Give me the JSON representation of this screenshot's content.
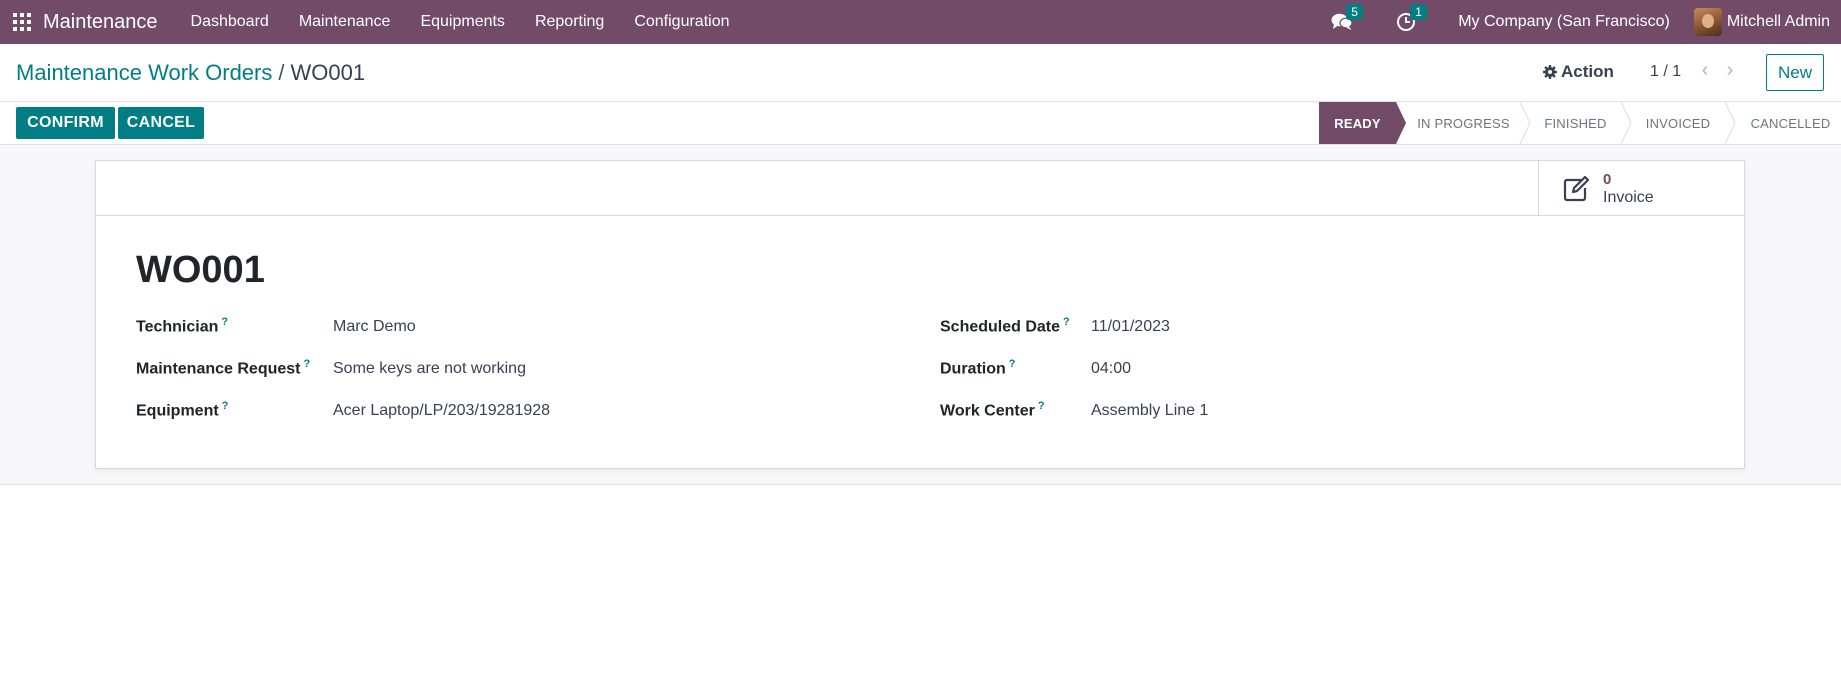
{
  "navbar": {
    "app_name": "Maintenance",
    "menus": [
      "Dashboard",
      "Maintenance",
      "Equipments",
      "Reporting",
      "Configuration"
    ],
    "messages_count": "5",
    "activities_count": "1",
    "company": "My Company (San Francisco)",
    "user": "Mitchell Admin"
  },
  "control": {
    "breadcrumb_parent": "Maintenance Work Orders",
    "breadcrumb_sep": "/",
    "breadcrumb_current": "WO001",
    "action_label": "Action",
    "pager": "1 / 1",
    "new_label": "New"
  },
  "statusbar": {
    "confirm_label": "CONFIRM",
    "cancel_label": "CANCEL",
    "stages": [
      "READY",
      "IN PROGRESS",
      "FINISHED",
      "INVOICED",
      "CANCELLED"
    ],
    "active_stage": "READY"
  },
  "form": {
    "invoice_count": "0",
    "invoice_label": "Invoice",
    "title": "WO001",
    "help_marker": "?",
    "left_fields": [
      {
        "label": "Technician",
        "value": "Marc Demo"
      },
      {
        "label": "Maintenance Request",
        "value": "Some keys are not working"
      },
      {
        "label": "Equipment",
        "value": "Acer Laptop/LP/203/19281928"
      }
    ],
    "right_fields": [
      {
        "label": "Scheduled Date",
        "value": "11/01/2023"
      },
      {
        "label": "Duration",
        "value": "04:00"
      },
      {
        "label": "Work Center",
        "value": "Assembly Line 1"
      }
    ]
  },
  "colors": {
    "brand": "#714b67",
    "accent": "#017e84"
  }
}
